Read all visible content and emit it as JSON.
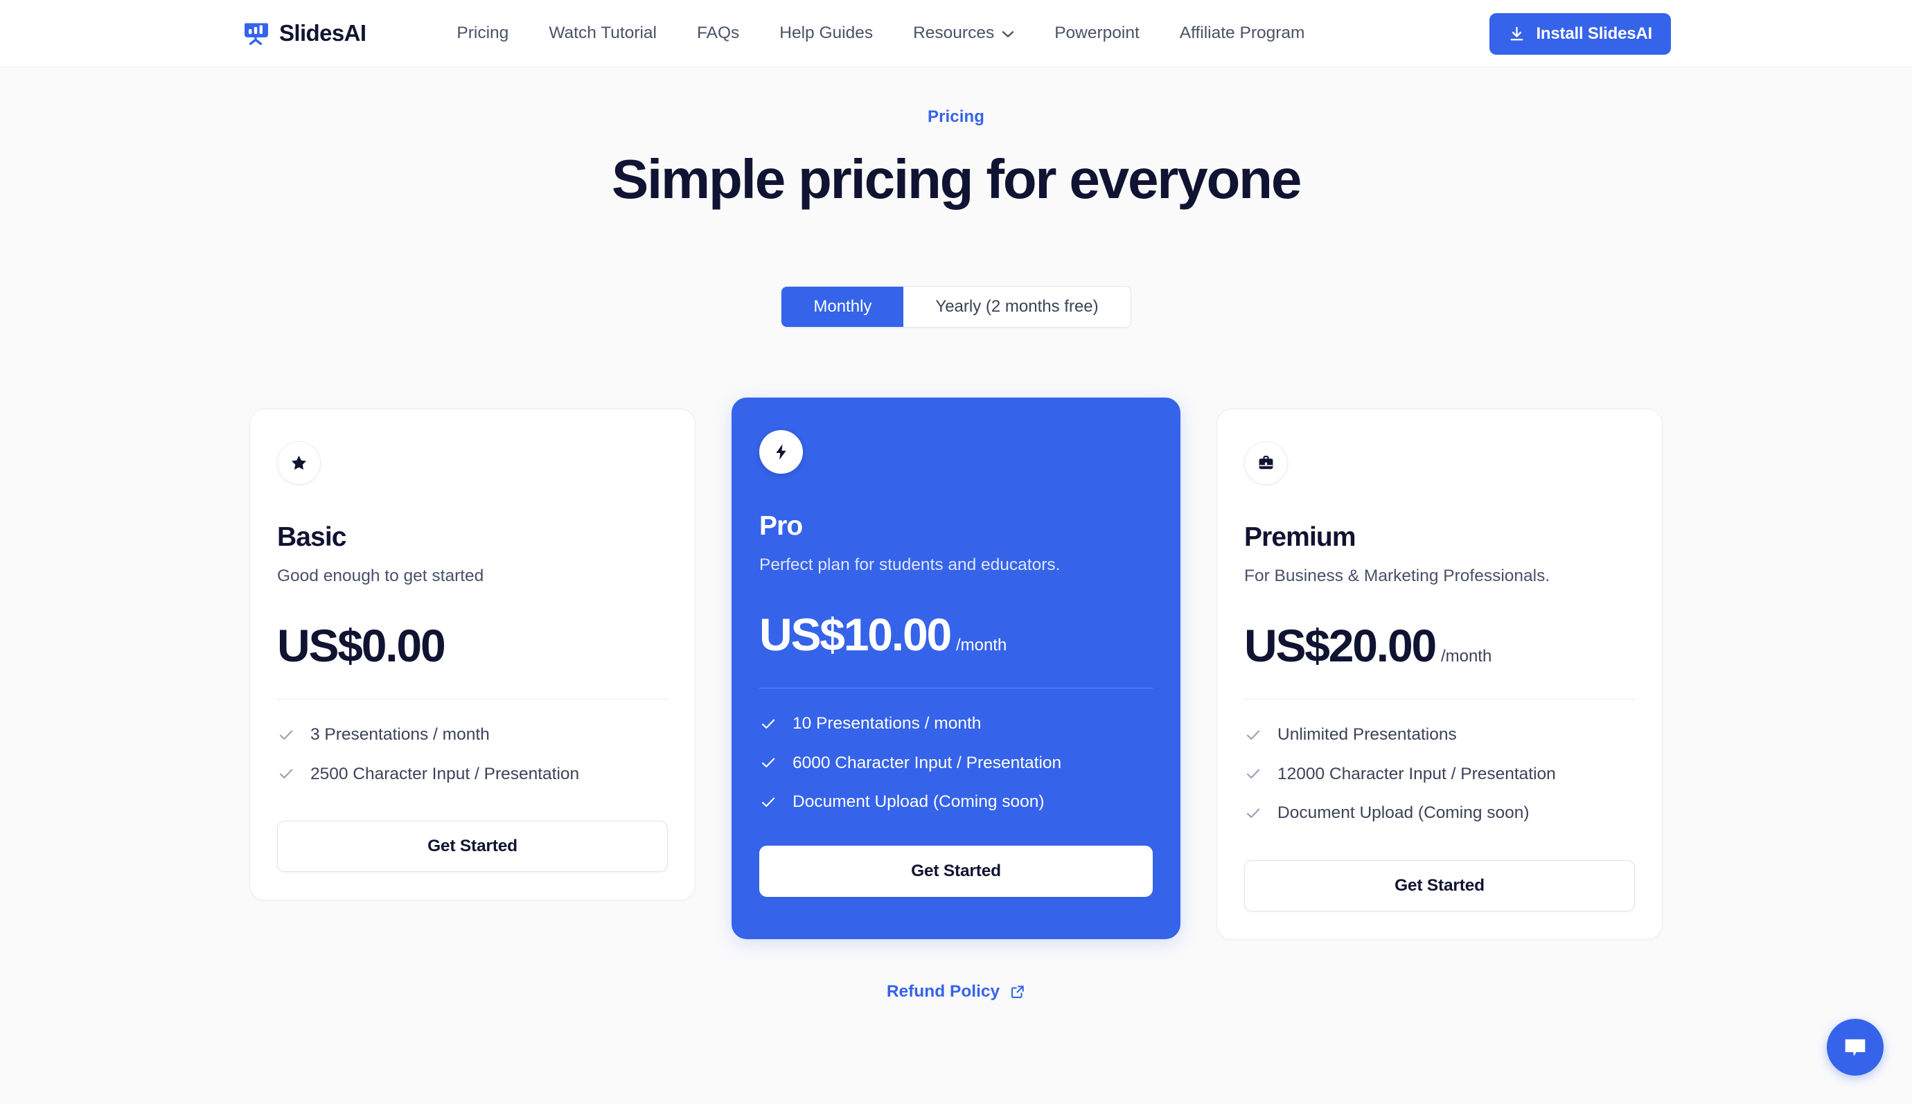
{
  "header": {
    "brand_name": "SlidesAI",
    "logo_icon": "slides-presentation-icon",
    "nav_items": [
      {
        "label": "Pricing",
        "has_chevron": false
      },
      {
        "label": "Watch Tutorial",
        "has_chevron": false
      },
      {
        "label": "FAQs",
        "has_chevron": false
      },
      {
        "label": "Help Guides",
        "has_chevron": false
      },
      {
        "label": "Resources",
        "has_chevron": true
      },
      {
        "label": "Powerpoint",
        "has_chevron": false
      },
      {
        "label": "Affiliate Program",
        "has_chevron": false
      }
    ],
    "install_button": {
      "label": "Install SlidesAI",
      "icon": "download-icon"
    }
  },
  "hero": {
    "eyebrow": "Pricing",
    "title": "Simple pricing for everyone"
  },
  "billing_toggle": {
    "options": [
      {
        "label": "Monthly",
        "active": true
      },
      {
        "label": "Yearly (2 months free)",
        "active": false
      }
    ]
  },
  "plans": [
    {
      "icon": "star-icon",
      "name": "Basic",
      "description": "Good enough to get started",
      "price": "US$0.00",
      "period": "",
      "features": [
        "3 Presentations / month",
        "2500 Character Input / Presentation"
      ],
      "cta_label": "Get Started",
      "featured": false
    },
    {
      "icon": "lightning-bolt-icon",
      "name": "Pro",
      "description": "Perfect plan for students and educators.",
      "price": "US$10.00",
      "period": "/month",
      "features": [
        "10 Presentations / month",
        "6000 Character Input / Presentation",
        "Document Upload (Coming soon)"
      ],
      "cta_label": "Get Started",
      "featured": true
    },
    {
      "icon": "briefcase-icon",
      "name": "Premium",
      "description": "For Business & Marketing Professionals.",
      "price": "US$20.00",
      "period": "/month",
      "features": [
        "Unlimited Presentations",
        "12000 Character Input / Presentation",
        "Document Upload (Coming soon)"
      ],
      "cta_label": "Get Started",
      "featured": false
    }
  ],
  "footer": {
    "refund_label": "Refund Policy",
    "refund_icon": "external-link-icon"
  },
  "chat_widget": {
    "icon": "chat-bubble-icon"
  },
  "colors": {
    "accent_blue": "#3563e9",
    "page_background": "#fafafb",
    "card_background": "#ffffff",
    "text_dark": "#101432",
    "text_muted": "#49506a",
    "border": "#ebedf1"
  }
}
